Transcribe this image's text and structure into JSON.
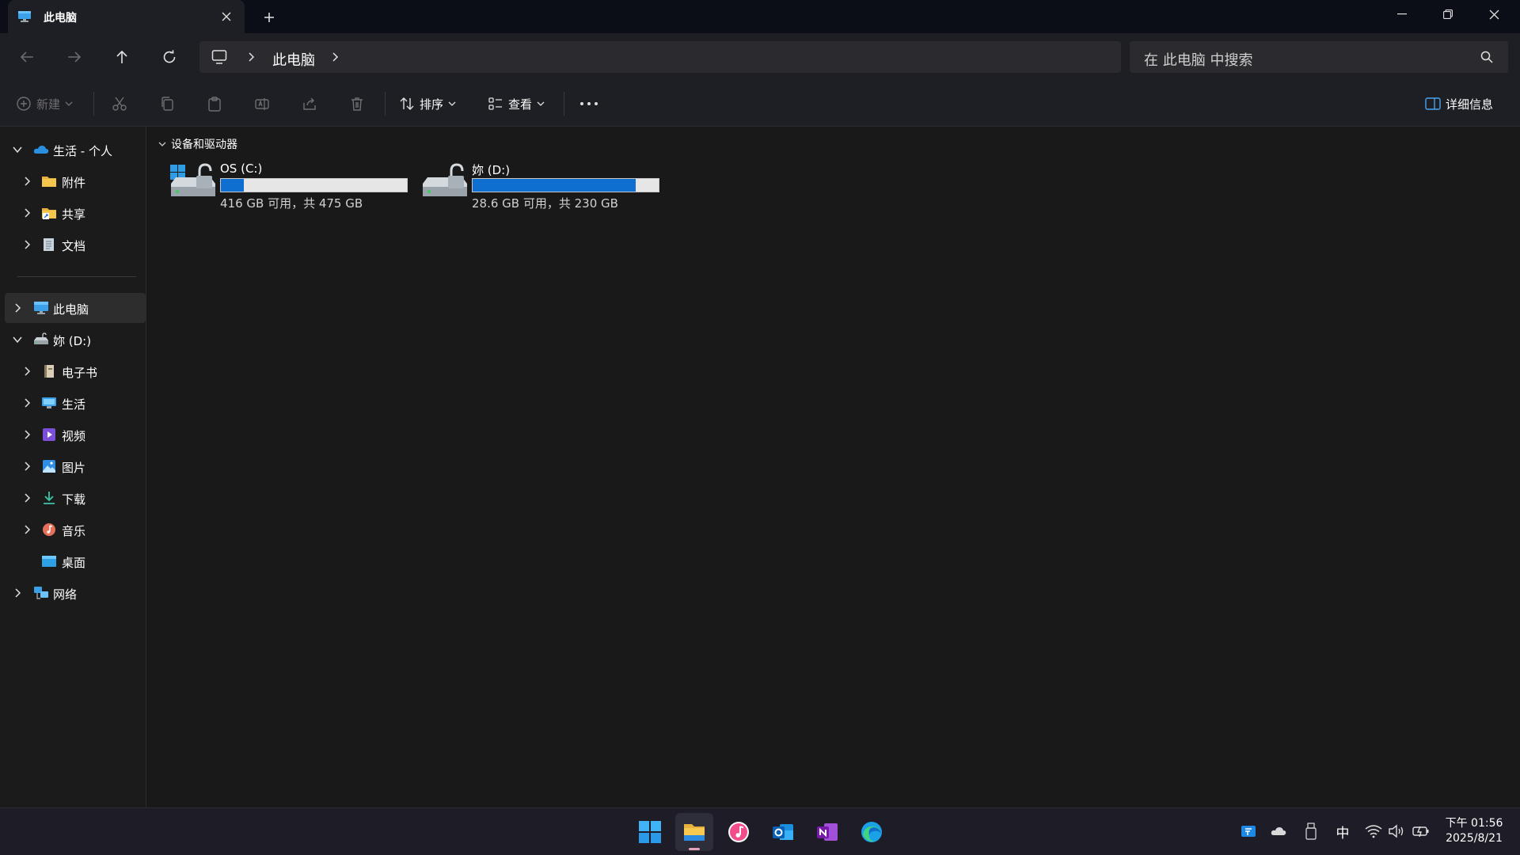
{
  "window": {
    "tab_title": "此电脑",
    "new_tab": "+"
  },
  "nav": {
    "breadcrumb": [
      "此电脑"
    ],
    "search_placeholder": "在 此电脑 中搜索"
  },
  "toolbar": {
    "new_label": "新建",
    "sort_label": "排序",
    "view_label": "查看",
    "details_label": "详细信息"
  },
  "sidebar": {
    "items": [
      {
        "label": "生活 - 个人",
        "icon": "onedrive-icon"
      },
      {
        "label": "附件",
        "icon": "folder-icon"
      },
      {
        "label": "共享",
        "icon": "shared-folder-icon"
      },
      {
        "label": "文档",
        "icon": "documents-icon"
      },
      {
        "label": "此电脑",
        "icon": "this-pc-icon"
      },
      {
        "label": "妳 (D:)",
        "icon": "drive-icon"
      },
      {
        "label": "电子书",
        "icon": "ebook-icon"
      },
      {
        "label": "生活",
        "icon": "desktop-folder-icon"
      },
      {
        "label": "视频",
        "icon": "videos-icon"
      },
      {
        "label": "图片",
        "icon": "pictures-icon"
      },
      {
        "label": "下载",
        "icon": "downloads-icon"
      },
      {
        "label": "音乐",
        "icon": "music-icon"
      },
      {
        "label": "桌面",
        "icon": "desktop-icon"
      },
      {
        "label": "网络",
        "icon": "network-icon"
      }
    ]
  },
  "main": {
    "group_title": "设备和驱动器",
    "drives": [
      {
        "name": "OS (C:)",
        "info": "416 GB 可用，共 475 GB",
        "used_fraction": 0.124
      },
      {
        "name": "妳 (D:)",
        "info": "28.6 GB 可用，共 230 GB",
        "used_fraction": 0.876
      }
    ]
  },
  "taskbar": {
    "apps": [
      "start-icon",
      "file-explorer-icon",
      "itunes-icon",
      "outlook-icon",
      "onenote-icon",
      "edge-icon"
    ],
    "ime": "中",
    "clock_time": "下午 01:56",
    "clock_date": "2025/8/21"
  },
  "colors": {
    "accent": "#0f6fd1",
    "background": "#191919",
    "chrome": "#1e1f24"
  }
}
